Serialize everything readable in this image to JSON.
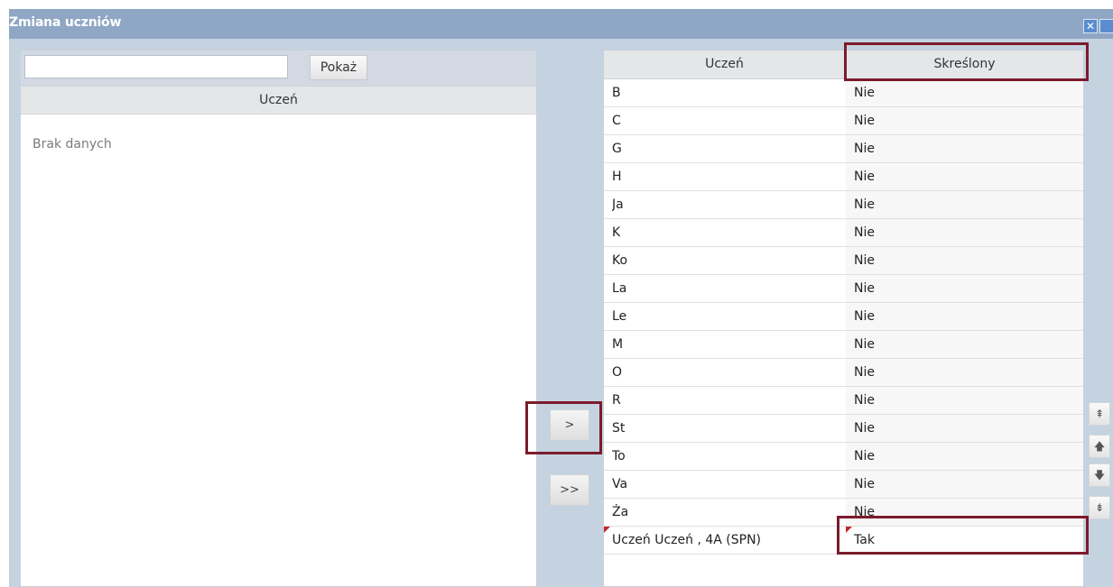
{
  "window": {
    "title": "Zmiana uczniów",
    "close_glyph": "✕"
  },
  "left": {
    "search": {
      "value": "",
      "placeholder": ""
    },
    "show_button": "Pokaż",
    "column_header": "Uczeń",
    "empty_text": "Brak danych"
  },
  "move": {
    "single": ">",
    "all": ">>"
  },
  "right": {
    "columns": [
      "Uczeń",
      "Skreślony"
    ],
    "rows": [
      {
        "name": "B",
        "skreslony": "Nie"
      },
      {
        "name": "C",
        "skreslony": "Nie"
      },
      {
        "name": "G",
        "skreslony": "Nie"
      },
      {
        "name": "H",
        "skreslony": "Nie"
      },
      {
        "name": "Ja",
        "skreslony": "Nie"
      },
      {
        "name": "K",
        "skreslony": "Nie"
      },
      {
        "name": "Ko",
        "skreslony": "Nie"
      },
      {
        "name": "La",
        "skreslony": "Nie"
      },
      {
        "name": "Le",
        "skreslony": "Nie"
      },
      {
        "name": "M",
        "skreslony": "Nie"
      },
      {
        "name": "O",
        "skreslony": "Nie"
      },
      {
        "name": "R",
        "skreslony": "Nie"
      },
      {
        "name": "St",
        "skreslony": "Nie"
      },
      {
        "name": "To",
        "skreslony": "Nie"
      },
      {
        "name": "Va",
        "skreslony": "Nie"
      },
      {
        "name": "Ża",
        "skreslony": "Nie"
      },
      {
        "name": "Uczeń Uczeń , 4A (SPN)",
        "skreslony": "Tak"
      }
    ]
  },
  "order": {
    "top": "⇞",
    "up": "🡅",
    "down": "🡇",
    "bottom": "⇟"
  },
  "colors": {
    "titlebar": "#8fa7c4",
    "window_bg": "#c5d3e0",
    "highlight": "#7b1b2d",
    "dirty_marker": "#c0282d"
  }
}
